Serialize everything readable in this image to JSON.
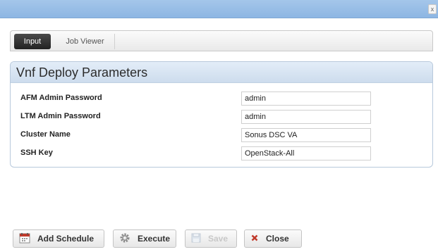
{
  "titlebar": {
    "close_glyph": "x"
  },
  "tabs": [
    {
      "label": "Input",
      "active": true
    },
    {
      "label": "Job Viewer",
      "active": false
    }
  ],
  "panel": {
    "title": "Vnf Deploy Parameters",
    "rows": [
      {
        "label": "AFM Admin Password",
        "value": "admin"
      },
      {
        "label": "LTM Admin Password",
        "value": "admin"
      },
      {
        "label": "Cluster Name",
        "value": "Sonus DSC VA"
      },
      {
        "label": "SSH Key",
        "value": "OpenStack-All"
      }
    ]
  },
  "buttons": {
    "add_schedule": "Add Schedule",
    "execute": "Execute",
    "save": "Save",
    "close": "Close"
  },
  "icons": {
    "calendar": "calendar-icon",
    "gear": "gear-icon",
    "save": "save-icon",
    "close": "close-icon"
  },
  "colors": {
    "titlebar": "#8db6e3",
    "panel_header": "#d6e3f2",
    "active_tab": "#2f2f2f",
    "close_icon": "#c0392b",
    "calendar_icon": "#c0392b"
  }
}
